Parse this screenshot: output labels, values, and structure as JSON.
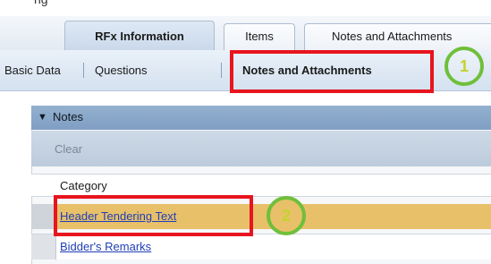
{
  "top_fragment": "ng",
  "tabs": [
    {
      "label": "RFx Information",
      "active": true
    },
    {
      "label": "Items",
      "active": false
    },
    {
      "label": "Notes and Attachments",
      "active": false
    }
  ],
  "subnav": [
    {
      "label": "Basic Data",
      "active": false
    },
    {
      "label": "Questions",
      "active": false
    },
    {
      "label": "Notes and Attachments",
      "active": true
    }
  ],
  "notes": {
    "toggle_icon": "triangle-down-icon",
    "title": "Notes",
    "clear_label": "Clear",
    "column_header": "Category",
    "rows": [
      {
        "label": "Header Tendering Text",
        "selected": true
      },
      {
        "label": "Bidder's Remarks",
        "selected": false
      }
    ]
  },
  "annotations": {
    "badge1": "1",
    "badge2": "2",
    "highlight_color": "#e8141e",
    "badge_color": "#6fbf3a"
  },
  "colors": {
    "selected_row": "#e8c06a",
    "link": "#1f3fb6"
  }
}
